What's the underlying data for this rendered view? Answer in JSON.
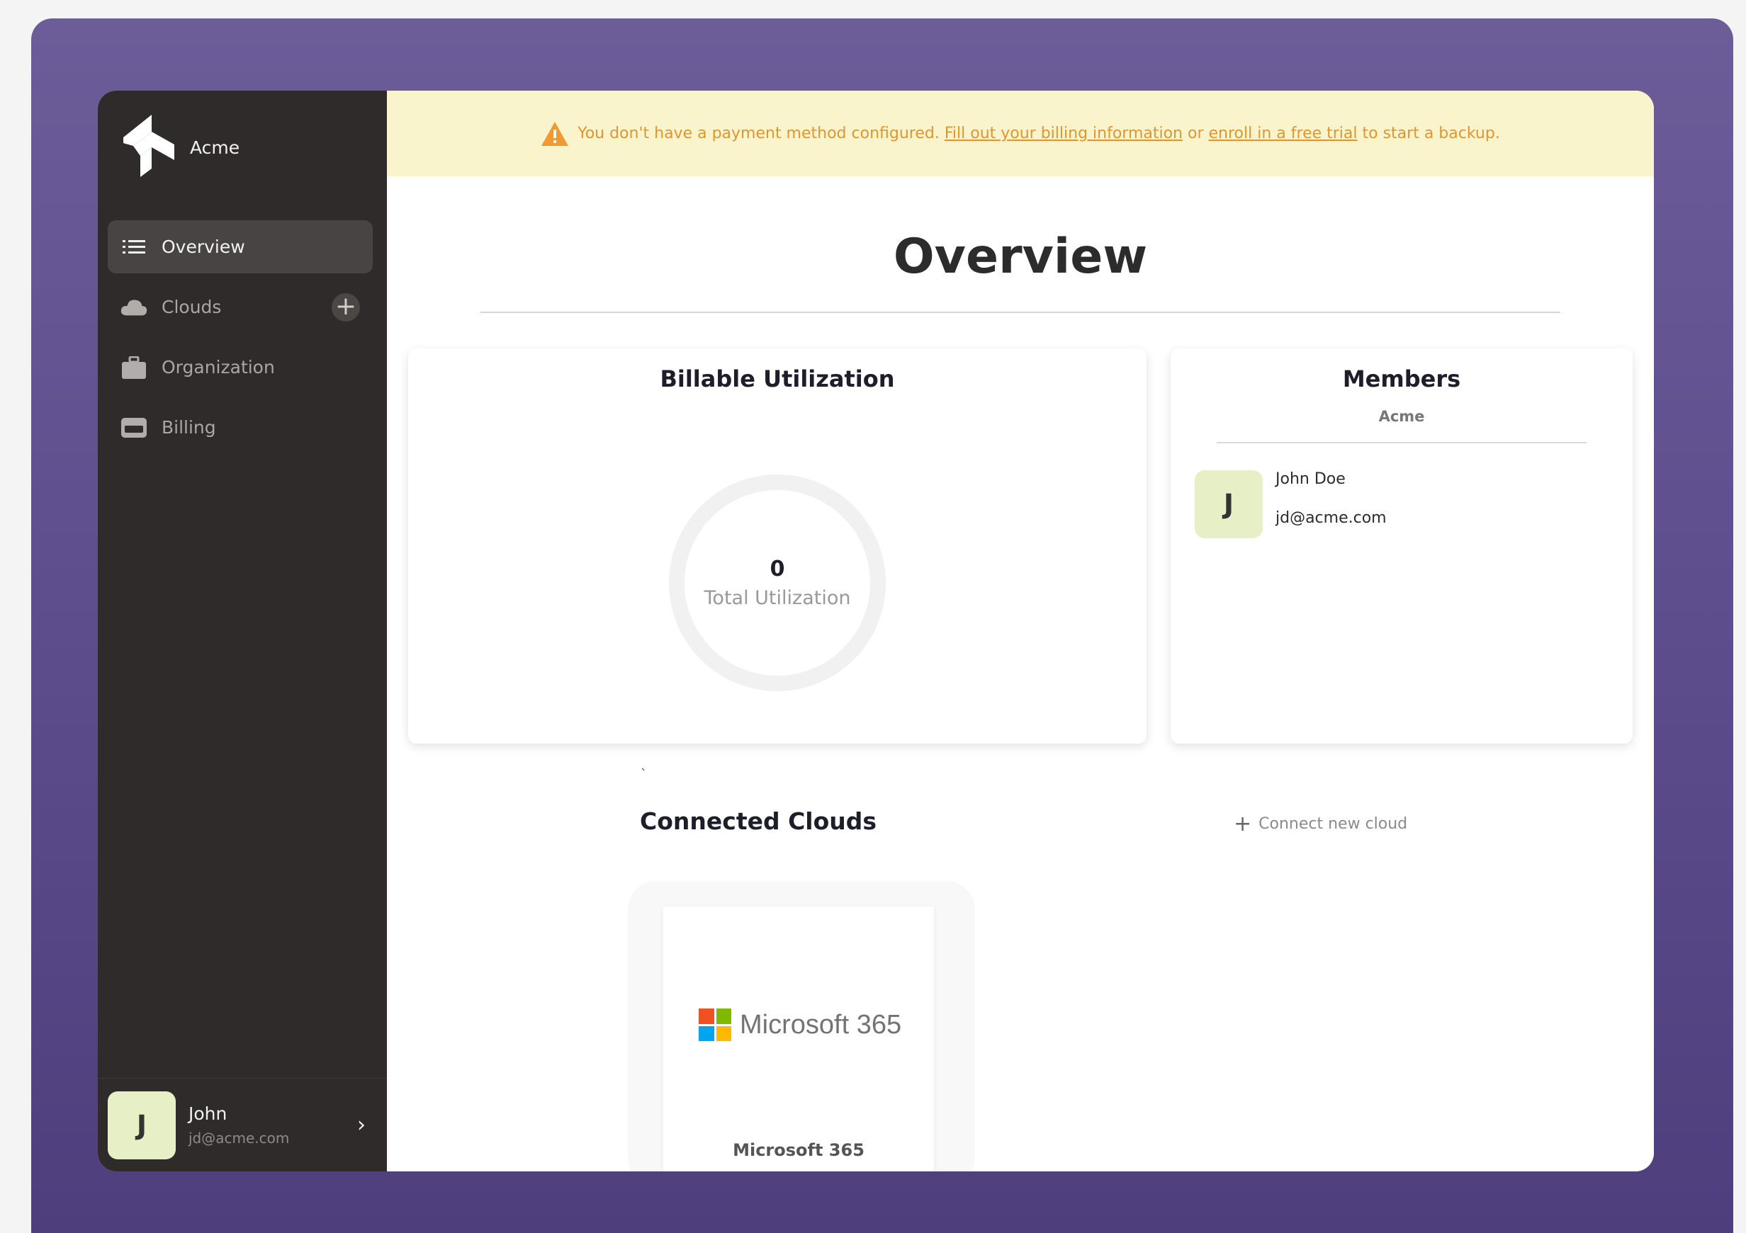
{
  "brand": {
    "name": "Acme"
  },
  "nav": {
    "items": [
      {
        "label": "Overview",
        "icon": "list-icon",
        "active": true
      },
      {
        "label": "Clouds",
        "icon": "cloud-icon"
      },
      {
        "label": "Organization",
        "icon": "briefcase-icon"
      },
      {
        "label": "Billing",
        "icon": "credit-card-icon"
      }
    ],
    "add_label": "+"
  },
  "user": {
    "initial": "J",
    "name": "John",
    "email": "jd@acme.com",
    "chevron": "›"
  },
  "banner": {
    "text_before": "You don't have a payment method configured.",
    "link_billing": "Fill out your billing information",
    "text_or": "or",
    "link_trial": "enroll in a free trial",
    "text_after": "to start a backup.",
    "color": "#e0962e"
  },
  "page": {
    "title": "Overview"
  },
  "utilization": {
    "title": "Billable Utilization",
    "value": "0",
    "label": "Total Utilization"
  },
  "members": {
    "title": "Members",
    "org": "Acme",
    "list": [
      {
        "initial": "J",
        "name": "John Doe",
        "email": "jd@acme.com"
      }
    ]
  },
  "stray_mark": "`",
  "clouds": {
    "title": "Connected Clouds",
    "connect_label": "Connect new cloud",
    "connect_plus": "+",
    "items": [
      {
        "logo_text": "Microsoft 365",
        "caption": "Microsoft 365"
      }
    ]
  },
  "colors": {
    "accent_purple": "#6c5c98",
    "sidebar": "#2e2b2a",
    "avatar_bg": "#e7efc6",
    "banner_bg": "#faf4cd"
  }
}
